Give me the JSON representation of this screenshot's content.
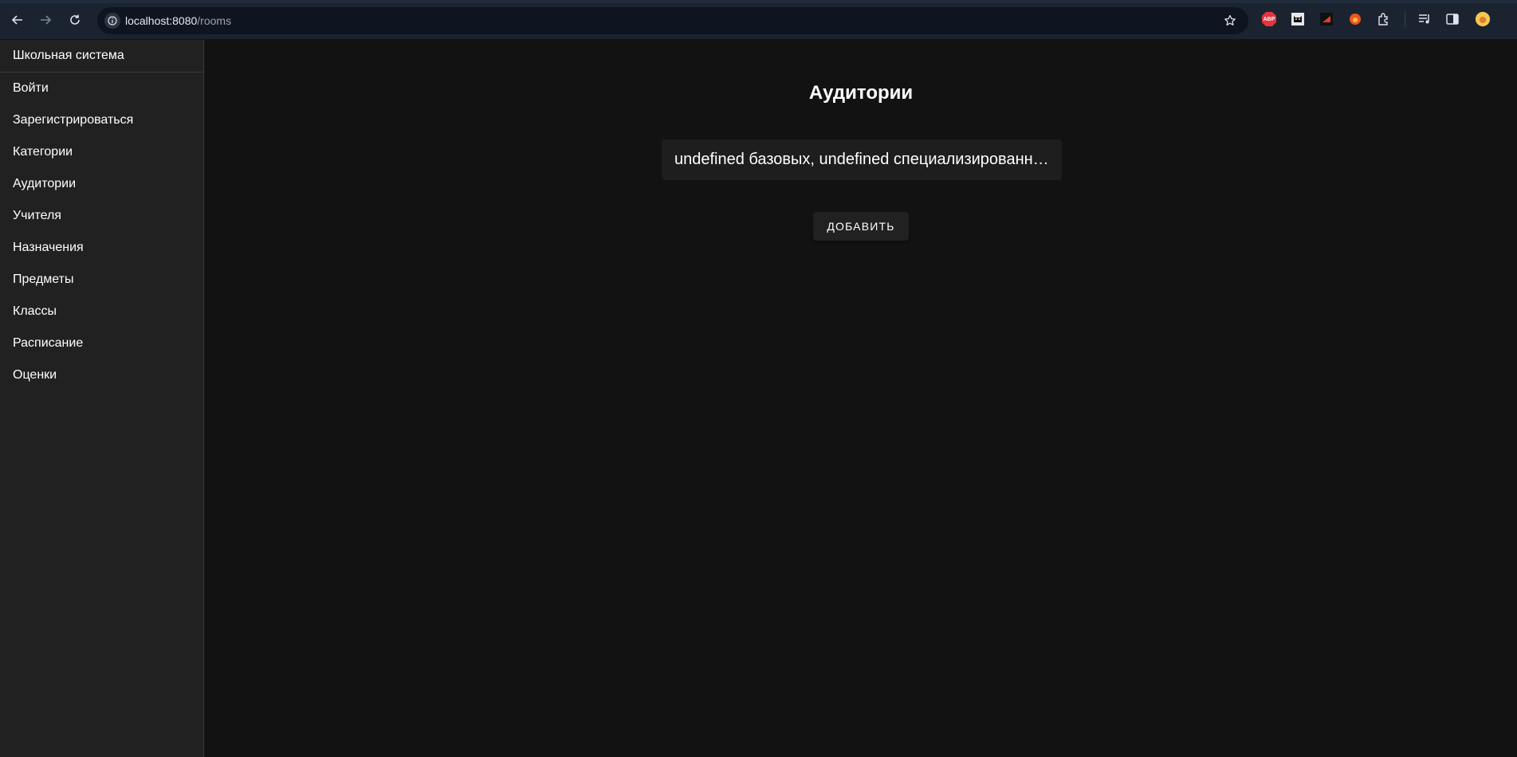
{
  "browser": {
    "url_host": "localhost:8080",
    "url_path": "/rooms",
    "extensions": [
      "abp-icon",
      "cat-icon",
      "red-arrow-icon",
      "fox-icon",
      "puzzle-icon",
      "media-icon",
      "sidepanel-icon",
      "avatar"
    ],
    "abp_label": "ABP"
  },
  "sidebar": {
    "brand": "Школьная система",
    "items": [
      {
        "label": "Войти"
      },
      {
        "label": "Зарегистрироваться"
      },
      {
        "label": "Категории"
      },
      {
        "label": "Аудитории"
      },
      {
        "label": "Учителя"
      },
      {
        "label": "Назначения"
      },
      {
        "label": "Предметы"
      },
      {
        "label": "Классы"
      },
      {
        "label": "Расписание"
      },
      {
        "label": "Оценки"
      }
    ]
  },
  "main": {
    "title": "Аудитории",
    "rooms": [
      {
        "text": "undefined базовых, undefined специализированных"
      }
    ],
    "add_label": "Добавить"
  },
  "colors": {
    "background": "#121212",
    "sidebar": "#212121",
    "card": "#1e1e1e",
    "chrome": "#1b2330"
  }
}
